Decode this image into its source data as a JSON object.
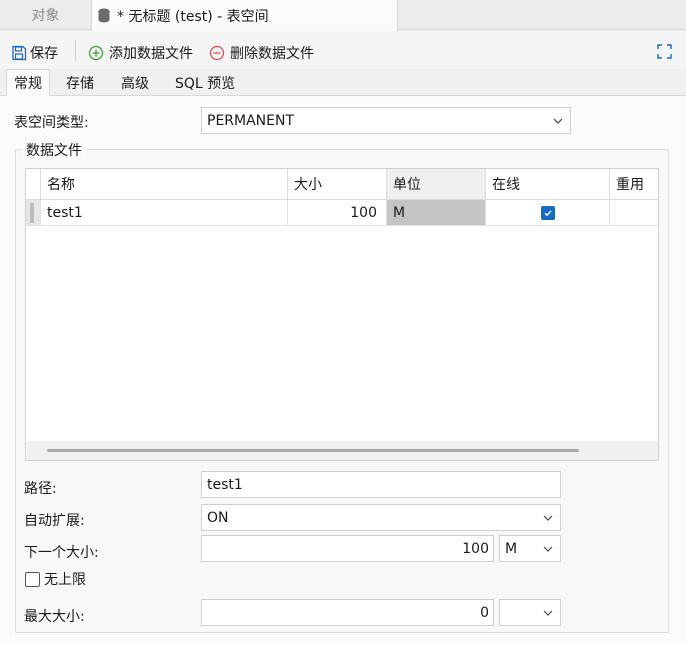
{
  "tabs": {
    "objects": "对象",
    "active_title": "* 无标题 (test) - 表空间"
  },
  "toolbar": {
    "save": "保存",
    "add_datafile": "添加数据文件",
    "delete_datafile": "删除数据文件"
  },
  "subtabs": [
    "常规",
    "存储",
    "高级",
    "SQL 预览"
  ],
  "form": {
    "tablespace_type_label": "表空间类型:",
    "tablespace_type_value": "PERMANENT",
    "datafile_group_label": "数据文件",
    "path_label": "路径:",
    "path_value": "test1",
    "autoextend_label": "自动扩展:",
    "autoextend_value": "ON",
    "next_size_label": "下一个大小:",
    "next_size_value": "100",
    "next_size_unit": "M",
    "unlimited_label": "无上限",
    "max_size_label": "最大大小:",
    "max_size_value": "0",
    "max_size_unit": ""
  },
  "grid": {
    "columns": [
      "名称",
      "大小",
      "单位",
      "在线",
      "重用"
    ],
    "rows": [
      {
        "name": "test1",
        "size": "100",
        "unit": "M",
        "online": true,
        "reuse": ""
      }
    ]
  },
  "colors": {
    "accent": "#1769c4",
    "add_icon": "#3aa33a",
    "delete_icon": "#d9534f",
    "selected_cell": "#c4c4c4"
  }
}
